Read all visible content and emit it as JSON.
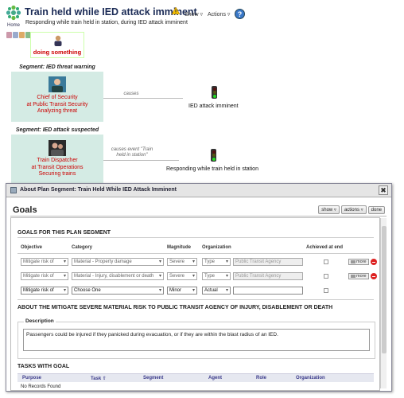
{
  "header": {
    "home_label": "Home",
    "title": "Train held while IED attack imminent",
    "subtitle": "Responding while train held in station, during IED attack imminent",
    "menus": [
      "Show",
      "Actions"
    ],
    "help_label": "?"
  },
  "flow": {
    "actor_label": "doing something",
    "segments": [
      {
        "title": "Segment: IED threat warning",
        "node_lines": [
          "Chief of Security",
          "at Public Transit Security",
          "Analyzing threat"
        ],
        "arrow_label": "causes",
        "outcome": "IED attack imminent"
      },
      {
        "title": "Segment: IED attack suspected",
        "node_lines": [
          "Train Dispatcher",
          "at Transit Operations",
          "Securing trains"
        ],
        "arrow_label_lines": [
          "causes event \"Train",
          "held in station\""
        ],
        "outcome": "Responding while train held in station"
      }
    ]
  },
  "dialog": {
    "title": "About Plan Segment: Train Held While IED Attack Imminent",
    "close_label": "✖",
    "heading": "Goals",
    "buttons": [
      "show ▿",
      "actions ▿",
      "done"
    ],
    "goals_section": "GOALS FOR THIS PLAN SEGMENT",
    "columns": [
      "Objective",
      "Category",
      "Magnitude",
      "Organization",
      "Achieved at end"
    ],
    "rows": [
      {
        "objective": "Mitigate risk of",
        "category": "Material - Property damage",
        "magnitude": "Severe",
        "org_type": "Type",
        "organization": "Public Transit Agency",
        "more": "more",
        "active": false
      },
      {
        "objective": "Mitigate risk of",
        "category": "Material - Injury, disablement or death",
        "magnitude": "Severe",
        "org_type": "Type",
        "organization": "Public Transit Agency",
        "more": "more",
        "active": false
      },
      {
        "objective": "Mitigate risk of",
        "category": "Choose One",
        "magnitude": "Minor",
        "org_type": "Actual",
        "organization": "",
        "active": true
      }
    ],
    "about_section": "ABOUT THE MITIGATE SEVERE MATERIAL RISK TO PUBLIC TRANSIT AGENCY OF INJURY, DISABLEMENT OR DEATH",
    "description_legend": "Description",
    "description_text": "Passengers could be injured if they panicked during evacuation, or if they are within the blast radius of an IED.",
    "tasks_section": "TASKS WITH GOAL",
    "task_columns": [
      "Purpose",
      "Task ⇧",
      "Segment",
      "Agent",
      "Role",
      "Organization"
    ],
    "no_records": "No Records Found"
  },
  "colors": {
    "title": "#1a2a55",
    "node_text": "#cc0000",
    "segment_bg": "#d4ebe4",
    "delete": "#dd2222",
    "header_link": "#3a3a8a"
  }
}
